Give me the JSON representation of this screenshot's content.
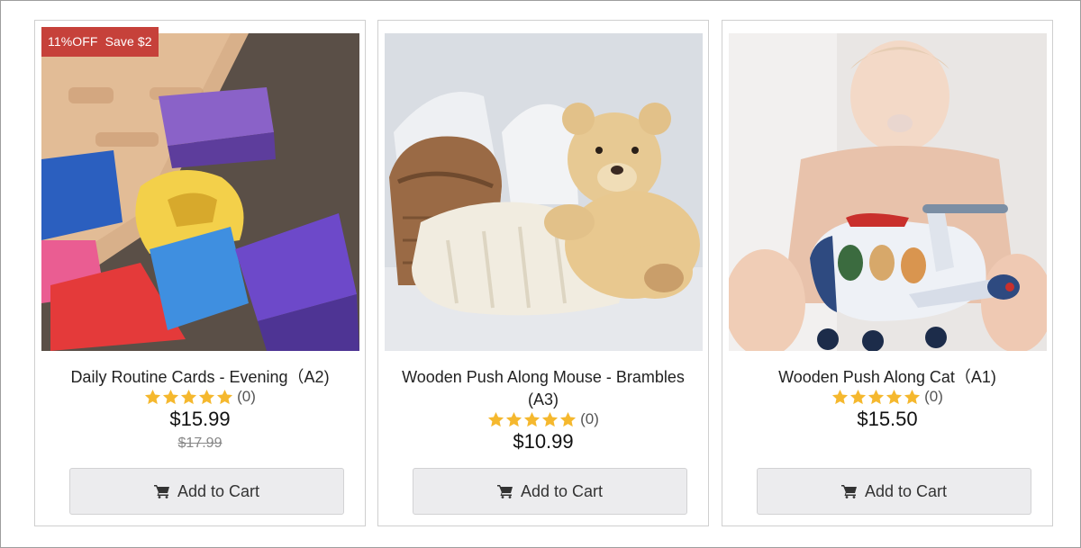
{
  "products": [
    {
      "badge": {
        "discount": "11%OFF",
        "save": "Save $2"
      },
      "title": "Daily Routine Cards - Evening（A2)",
      "rating_stars": 5,
      "review_count": "(0)",
      "price": "$15.99",
      "old_price": "$17.99",
      "button_label": "Add to Cart",
      "button_icon": "cart-icon"
    },
    {
      "title": "Wooden Push Along Mouse - Brambles (A3)",
      "rating_stars": 5,
      "review_count": "(0)",
      "price": "$10.99",
      "button_label": "Add to Cart",
      "button_icon": "cart-icon"
    },
    {
      "title": "Wooden Push Along Cat（A1)",
      "rating_stars": 5,
      "review_count": "(0)",
      "price": "$15.50",
      "button_label": "Add to Cart",
      "button_icon": "cart-icon"
    }
  ],
  "colors": {
    "badge": "#c6413a",
    "star": "#f5b82e",
    "button_bg": "#ececee"
  }
}
